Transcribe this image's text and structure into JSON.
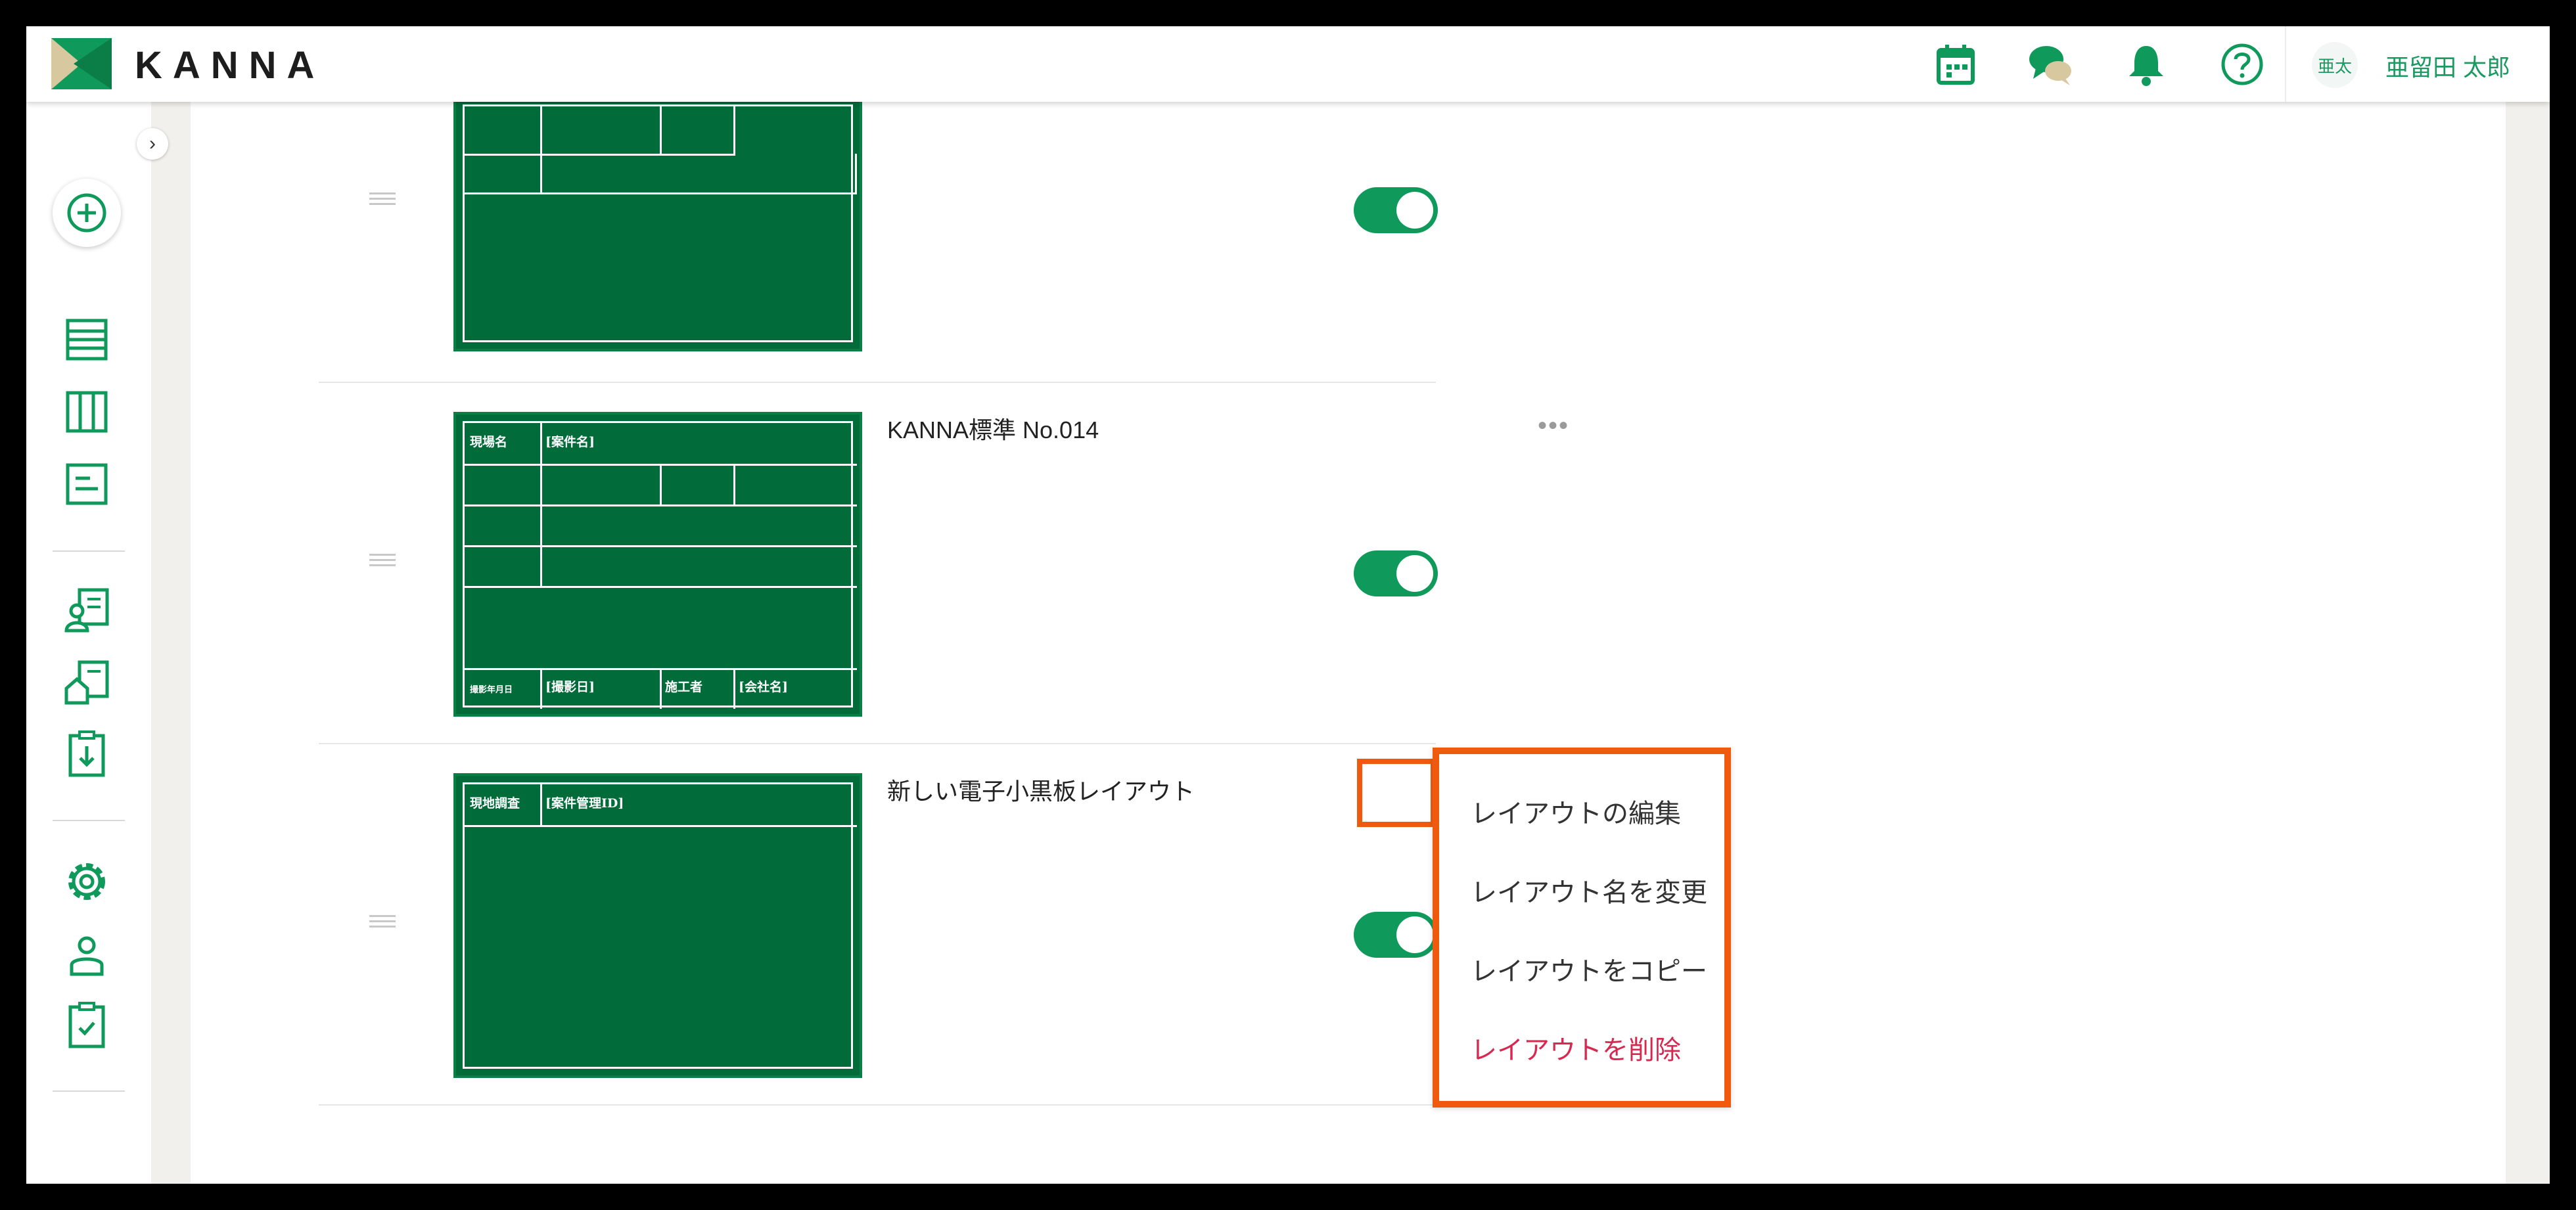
{
  "header": {
    "brand": "KANNA",
    "icons": [
      "calendar-icon",
      "chat-icon",
      "bell-icon",
      "help-icon"
    ],
    "avatar_text": "亜太",
    "user_name": "亜留田 太郎"
  },
  "sidebar": {
    "expand_glyph": "›",
    "items": [
      "add-icon",
      "list-icon",
      "board-icon",
      "report-icon",
      "person-doc-icon",
      "house-doc-icon",
      "download-doc-icon",
      "settings-icon",
      "user-icon",
      "checklist-icon"
    ]
  },
  "layouts": [
    {
      "title": "",
      "enabled": true
    },
    {
      "title": "KANNA標準 No.014",
      "enabled": true,
      "board_labels": {
        "site": "現場名",
        "project": "[案件名]",
        "date_label": "撮影年月日",
        "date": "[撮影日]",
        "builder": "施工者",
        "company": "[会社名]"
      }
    },
    {
      "title": "新しい電子小黒板レイアウト",
      "enabled": true,
      "board_labels": {
        "survey": "現地調査",
        "project_id": "[案件管理ID]"
      }
    }
  ],
  "more_glyph": "•••",
  "context_menu": {
    "items": [
      {
        "label": "レイアウトの編集",
        "danger": false
      },
      {
        "label": "レイアウト名を変更",
        "danger": false
      },
      {
        "label": "レイアウトをコピー",
        "danger": false
      },
      {
        "label": "レイアウトを削除",
        "danger": true
      }
    ]
  },
  "colors": {
    "accent": "#0f9a5b",
    "board": "#016b3a",
    "highlight": "#f05a0e",
    "danger": "#d8284f"
  }
}
